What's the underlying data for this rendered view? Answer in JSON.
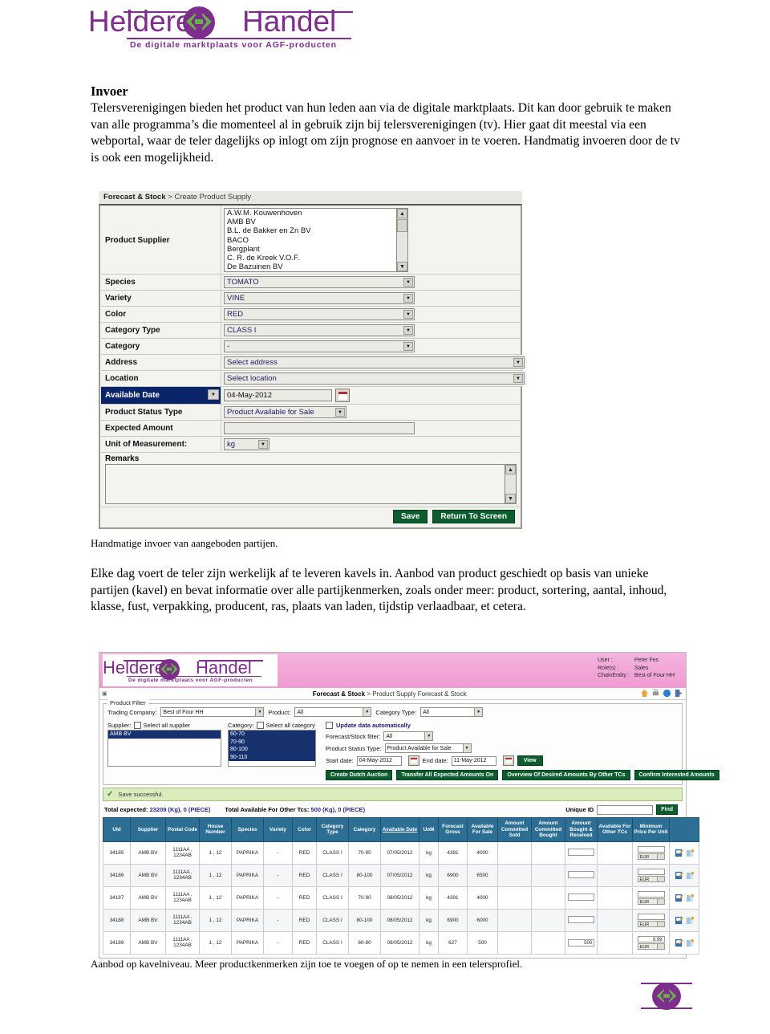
{
  "brand": {
    "word_left": "Heldere",
    "word_right": "Handel",
    "tagline": "De digitale marktplaats voor AGF-producten"
  },
  "doc": {
    "section_title": "Invoer",
    "paragraph1": "Telersverenigingen bieden het product van hun leden aan via de digitale marktplaats. Dit kan door gebruik te maken van alle programma’s die momenteel al in gebruik zijn bij telersverenigingen (tv). Hier gaat dit meestal via een webportal, waar de teler dagelijks op inlogt om zijn prognose en aanvoer in te voeren. Handmatig invoeren door de tv is ook een mogelijkheid.",
    "caption1": "Handmatige invoer van aangeboden partijen.",
    "paragraph2": "Elke dag voert de teler zijn werkelijk af te leveren kavels in. Aanbod van product geschiedt op basis van unieke partijen (kavel) en bevat informatie over alle partijkenmerken, zoals onder meer: product, sortering, aantal, inhoud, klasse, fust, verpakking, producent, ras, plaats van laden, tijdstip verlaadbaar, et cetera.",
    "caption2": "Aanbod op kavelniveau. Meer productkenmerken zijn toe te voegen of op te nemen in een telersprofiel."
  },
  "form_screenshot": {
    "breadcrumb_bold": "Forecast & Stock",
    "breadcrumb_rest": "> Create Product Supply",
    "supplier_label": "Product Supplier",
    "supplier_options": [
      "A.W.M. Kouwenhoven",
      "AMB BV",
      "B.L. de Bakker en Zn BV",
      "BACO",
      "Bergplant",
      "C. R. de Kreek V.O.F.",
      "De Bazuinen BV"
    ],
    "fields": [
      {
        "label": "Species",
        "value": "TOMATO",
        "kind": "select",
        "width": "w-species"
      },
      {
        "label": "Variety",
        "value": "VINE",
        "kind": "select",
        "width": "w-species"
      },
      {
        "label": "Color",
        "value": "RED",
        "kind": "select",
        "width": "w-species"
      },
      {
        "label": "Category Type",
        "value": "CLASS I",
        "kind": "select",
        "width": "w-species"
      },
      {
        "label": "Category",
        "value": "-",
        "kind": "select",
        "width": "w-species"
      },
      {
        "label": "Address",
        "value": "Select address",
        "kind": "select",
        "width": "w-wide"
      },
      {
        "label": "Location",
        "value": "Select location",
        "kind": "select",
        "width": "w-wide"
      }
    ],
    "available_date_label": "Available Date",
    "available_date_value": "04-May-2012",
    "status_type_label": "Product Status Type",
    "status_type_value": "Product Available for Sale",
    "expected_amount_label": "Expected Amount",
    "expected_amount_value": "",
    "uom_label": "Unit of Measurement:",
    "uom_value": "kg",
    "remarks_label": "Remarks",
    "remarks_value": "",
    "save_label": "Save",
    "return_label": "Return To Screen"
  },
  "grid_screenshot": {
    "user_rows": [
      {
        "key": "User :",
        "val": "Peter Fes"
      },
      {
        "key": "Role(s) :",
        "val": "Sales"
      },
      {
        "key": "ChainEntity :",
        "val": "Best of Four HH"
      }
    ],
    "breadcrumb_bold": "Forecast & Stock",
    "breadcrumb_rest": "> Product Supply Forecast & Stock",
    "filter_legend": "Product Filter",
    "trading_company_label": "Trading Company:",
    "trading_company_value": "Best of Four HH",
    "product_label": "Product:",
    "product_value": "All",
    "category_type_label": "Category Type:",
    "category_type_value": "All",
    "supplier_label": "Supplier:",
    "select_all_supplier": "Select all supplier",
    "supplier_options": [
      "AMB BV"
    ],
    "category_label": "Category:",
    "select_all_category": "Select all category",
    "category_options": [
      "60-70",
      "70-90",
      "80-100",
      "90-110"
    ],
    "update_auto_label": "Update data automatically",
    "forecast_filter_label": "Forecast/Stock filter:",
    "forecast_filter_value": "All",
    "status_type_label": "Product Status Type:",
    "status_type_value": "Product Available for Sale",
    "start_date_label": "Start date:",
    "start_date_value": "04-May-2012",
    "end_date_label": "End date:",
    "end_date_value": "11-May-2012",
    "view_label": "View",
    "action_buttons": [
      "Create Dutch Auction",
      "Transfer All Expected Amounts On",
      "Overview Of Desired Amounts By Other TCs",
      "Confirm Interested Amounts"
    ],
    "status_message": "Save successful.",
    "totals": [
      {
        "label": "Total expected:",
        "value": "23209 (Kg), 0 (PIECE)"
      },
      {
        "label": "Total Available For Other Tcs:",
        "value": "500 (Kg), 0 (PIECE)"
      }
    ],
    "unique_id_label": "Unique ID",
    "unique_id_value": "",
    "find_label": "Find",
    "columns": [
      "UId",
      "Supplier",
      "Postal Code",
      "House Number",
      "Species",
      "Variety",
      "Color",
      "Category Type",
      "Category",
      "Available Date",
      "UoM",
      "Forecast Gross",
      "Available For Sale",
      "Amount Committed Sold",
      "Amount Committed Bought",
      "Amount Bought & Received",
      "Available For Other TCs",
      "Minimum Price Per Unit",
      ""
    ],
    "rows": [
      {
        "uid": "34185",
        "supplier": "AMB BV",
        "postal": "1111AA , 1234AB",
        "house": "1 , 12",
        "species": "PAPRIKA",
        "variety": "-",
        "color": "RED",
        "cat_type": "CLASS I",
        "category": "70-90",
        "date": "07/05/2012",
        "uom": "kg",
        "forecast": "4391",
        "available": "4000",
        "committed_sold": "",
        "committed_bought": "",
        "bought_received": "",
        "other_tcs": "",
        "price": "",
        "currency": "EUR"
      },
      {
        "uid": "34186",
        "supplier": "AMB BV",
        "postal": "1111AA , 1234AB",
        "house": "1 , 12",
        "species": "PAPRIKA",
        "variety": "-",
        "color": "RED",
        "cat_type": "CLASS I",
        "category": "80-100",
        "date": "07/05/2012",
        "uom": "kg",
        "forecast": "6900",
        "available": "6500",
        "committed_sold": "",
        "committed_bought": "",
        "bought_received": "",
        "other_tcs": "",
        "price": "",
        "currency": "EUR"
      },
      {
        "uid": "34187",
        "supplier": "AMB BV",
        "postal": "1111AA , 1234AB",
        "house": "1 , 12",
        "species": "PAPRIKA",
        "variety": "-",
        "color": "RED",
        "cat_type": "CLASS I",
        "category": "70-90",
        "date": "08/05/2012",
        "uom": "kg",
        "forecast": "4391",
        "available": "4000",
        "committed_sold": "",
        "committed_bought": "",
        "bought_received": "",
        "other_tcs": "",
        "price": "",
        "currency": "EUR"
      },
      {
        "uid": "34188",
        "supplier": "AMB BV",
        "postal": "1111AA , 1234AB",
        "house": "1 , 12",
        "species": "PAPRIKA",
        "variety": "-",
        "color": "RED",
        "cat_type": "CLASS I",
        "category": "80-100",
        "date": "08/05/2012",
        "uom": "kg",
        "forecast": "6900",
        "available": "6000",
        "committed_sold": "",
        "committed_bought": "",
        "bought_received": "",
        "other_tcs": "",
        "price": "",
        "currency": "EUR"
      },
      {
        "uid": "34189",
        "supplier": "AMB BV",
        "postal": "1111AA , 1234AB",
        "house": "1 , 12",
        "species": "PAPRIKA",
        "variety": "-",
        "color": "RED",
        "cat_type": "CLASS I",
        "category": "60-80",
        "date": "08/05/2012",
        "uom": "kg",
        "forecast": "627",
        "available": "500",
        "committed_sold": "",
        "committed_bought": "",
        "bought_received": "500",
        "other_tcs": "",
        "price": "0.99",
        "currency": "EUR"
      }
    ]
  },
  "colors": {
    "brand_purple": "#7d2d8c",
    "button_green": "#0b5d2e",
    "grid_header_blue": "#2d6e94",
    "status_green_bg": "#dcecbf",
    "select_blue": "#17306e",
    "pink_banner": "#f09ad2"
  }
}
